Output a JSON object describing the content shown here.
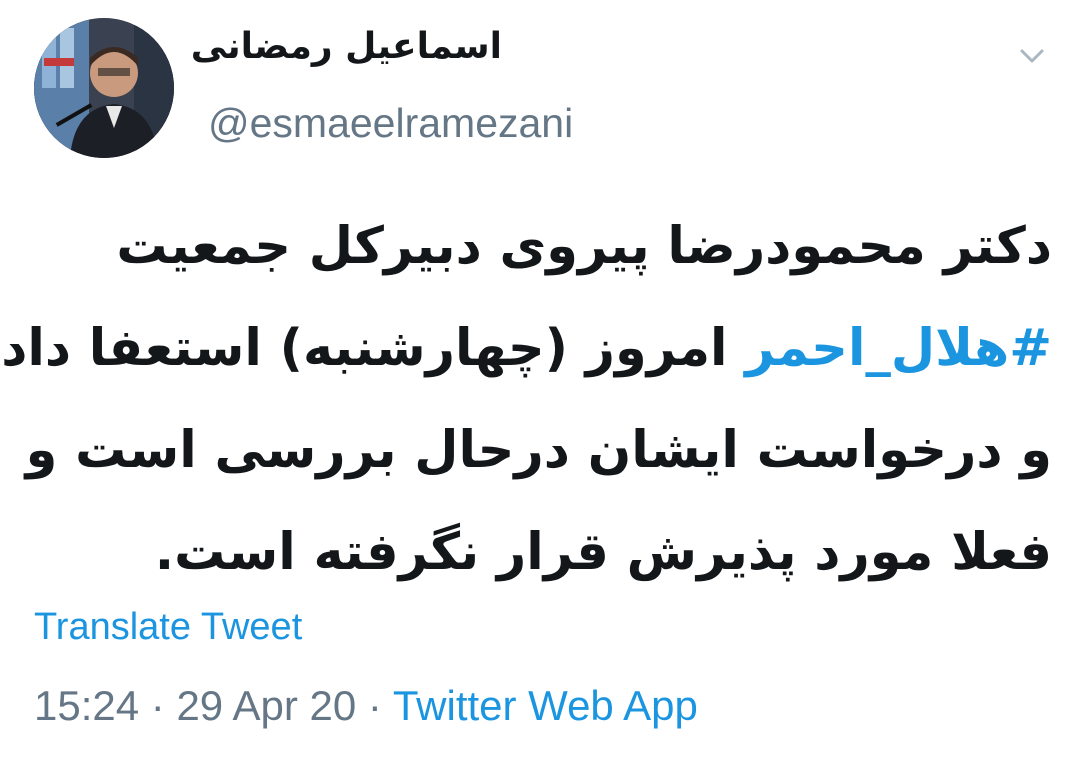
{
  "user": {
    "display_name": "اسماعیل رمضانی",
    "handle": "@esmaeelramezani",
    "avatar_icon": "profile-photo"
  },
  "menu": {
    "icon": "chevron-down-icon"
  },
  "tweet": {
    "line1": "دکتر محمودرضا پیروی دبیرکل جمعیت",
    "line2_hashtag": "#هلال_احمر",
    "line2_rest": " امروز (چهارشنبه) استعفا داده",
    "line3": "و درخواست ایشان درحال بررسی است و",
    "line4": "فعلا مورد پذیرش قرار نگرفته است."
  },
  "translate_label": "Translate Tweet",
  "meta": {
    "time": "15:24",
    "separator1": " · ",
    "date": "29 Apr 20",
    "separator2": " · ",
    "source": "Twitter Web App"
  },
  "colors": {
    "link": "#1b95e0",
    "secondary": "#657786",
    "text": "#14171a"
  }
}
